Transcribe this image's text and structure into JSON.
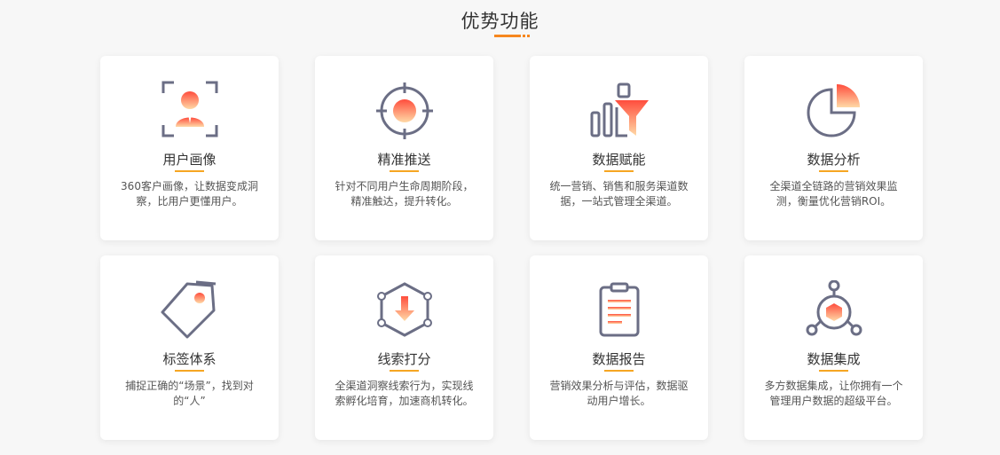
{
  "section": {
    "title": "优势功能"
  },
  "colors": {
    "accent": "#f6871f",
    "icon_stroke": "#6b6e85",
    "gradient_top": "#ff4d3d",
    "gradient_bottom": "#ffd9a6"
  },
  "cards": [
    {
      "icon": "user-profile-icon",
      "title": "用户画像",
      "desc": "360客户画像，让数据变成洞察，比用户更懂用户。"
    },
    {
      "icon": "target-icon",
      "title": "精准推送",
      "desc": "针对不同用户生命周期阶段，精准触达，提升转化。"
    },
    {
      "icon": "data-funnel-icon",
      "title": "数据赋能",
      "desc": "统一营销、销售和服务渠道数据，一站式管理全渠道。"
    },
    {
      "icon": "pie-chart-icon",
      "title": "数据分析",
      "desc": "全渠道全链路的营销效果监测，衡量优化营销ROI。"
    },
    {
      "icon": "tag-icon",
      "title": "标签体系",
      "desc": "捕捉正确的“场景”，找到对的“人”"
    },
    {
      "icon": "lead-score-icon",
      "title": "线索打分",
      "desc": "全渠道洞察线索行为，实现线索孵化培育，加速商机转化。"
    },
    {
      "icon": "report-clipboard-icon",
      "title": "数据报告",
      "desc": "营销效果分析与评估，数据驱动用户增长。"
    },
    {
      "icon": "data-integration-icon",
      "title": "数据集成",
      "desc": "多方数据集成，让你拥有一个管理用户数据的超级平台。"
    }
  ]
}
